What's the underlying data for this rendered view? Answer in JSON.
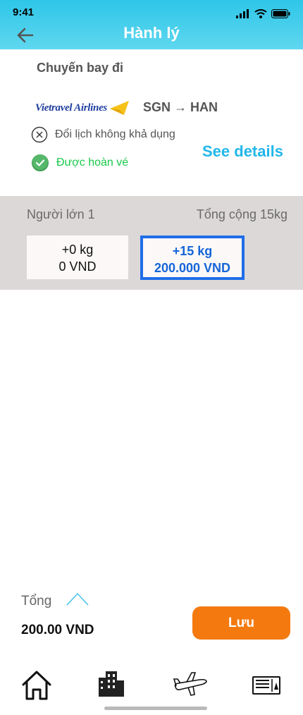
{
  "status_bar": {
    "time": "9:41"
  },
  "header": {
    "title": "Hành lý"
  },
  "flight": {
    "section_title": "Chuyến bay đi",
    "airline_name": "Vietravel Airlines",
    "route": "SGN → HAN",
    "reschedule_text": "Đổi lịch không khả dụng",
    "refund_text": "Được hoàn vé",
    "see_details": "See details"
  },
  "baggage": {
    "passenger_label": "Người lớn 1",
    "total_weight": "Tổng cộng 15kg",
    "options": [
      {
        "weight": "+0 kg",
        "price": "0 VND",
        "selected": false
      },
      {
        "weight": "+15 kg",
        "price": "200.000 VND",
        "selected": true
      }
    ]
  },
  "footer": {
    "total_label": "Tổng",
    "total_price": "200.00 VND",
    "save_label": "Lưu"
  },
  "nav": {
    "icons": [
      "home-icon",
      "building-icon",
      "airplane-icon",
      "ticket-icon"
    ]
  },
  "colors": {
    "header": "#2ec6e8",
    "accent": "#22b7ea",
    "save": "#f47a10",
    "selected": "#1f6ee8",
    "refund": "#19c94a"
  }
}
